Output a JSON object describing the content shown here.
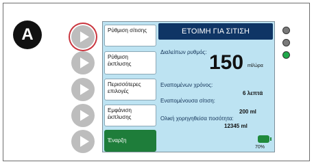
{
  "panel_label": "A",
  "status": {
    "title": "ΕΤΟΙΜΗ ΓΙΑ ΣΙΤΙΣΗ"
  },
  "side_buttons": [
    {
      "label": "Ρύθμιση σίτισης"
    },
    {
      "label": "Ρύθμιση έκπλυσης"
    },
    {
      "label": "Περισσότερες επιλογές"
    },
    {
      "label": "Εμφάνιση έκπλυσης"
    },
    {
      "label": "Έναρξη"
    }
  ],
  "info": {
    "rate_label": "Διαλείπων ρυθμός:",
    "rate_value": "150",
    "rate_unit": "ml/ώρα",
    "time_remaining_label": "Εναπομένων χρόνος:",
    "time_remaining_value": "6 λεπτά",
    "feed_remaining_label": "Εναπομένουσα σίτιση:",
    "feed_remaining_value": "200 ml",
    "total_delivered_label": "Ολική χορηγηθείσα ποσότητα:",
    "total_delivered_value": "12345 ml"
  },
  "battery": {
    "percent_text": "70%",
    "level": 0.7,
    "color": "#1f8a3c"
  },
  "indicators": [
    {
      "name": "indicator-1",
      "color": "#7a7a7a"
    },
    {
      "name": "indicator-2",
      "color": "#7a7a7a"
    },
    {
      "name": "indicator-3",
      "color": "#1fa84a"
    }
  ],
  "colors": {
    "status_bar": "#0f3565",
    "screen_bg": "#bde3f2",
    "start_button": "#1e7d3a",
    "selected_ring": "#c9353e"
  }
}
